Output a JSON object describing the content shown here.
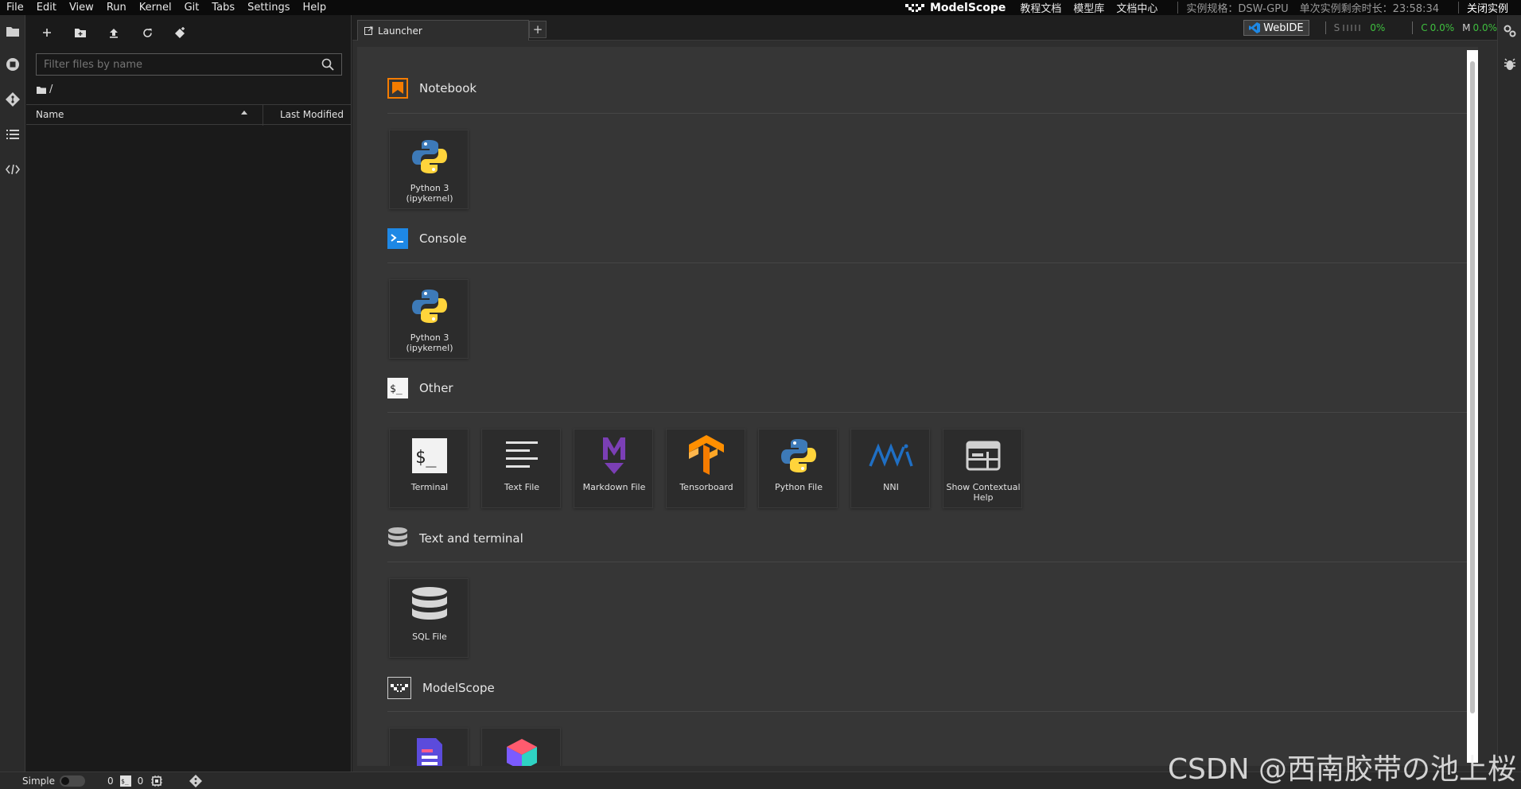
{
  "menu": {
    "items": [
      "File",
      "Edit",
      "View",
      "Run",
      "Kernel",
      "Git",
      "Tabs",
      "Settings",
      "Help"
    ],
    "brand": "ModelScope",
    "links": [
      "教程文档",
      "模型库",
      "文档中心"
    ],
    "instance_spec_label": "实例规格：DSW-GPU",
    "remaining_time_label": "单次实例剩余时长：23:58:34",
    "close_instance": "关闭实例"
  },
  "filebrowser": {
    "filter_placeholder": "Filter files by name",
    "breadcrumb": "/",
    "col_name": "Name",
    "col_modified": "Last Modified"
  },
  "tabs": {
    "launcher_label": "Launcher",
    "add_label": "+"
  },
  "widgets": {
    "webide_label": "WebIDE",
    "s_label": "S",
    "s_value": "0%",
    "c_label": "C",
    "c_value": "0.0%",
    "m_label": "M",
    "m_value": "0.0%"
  },
  "launcher": {
    "sections": [
      {
        "title": "Notebook",
        "icon": "notebook-icon",
        "items": [
          {
            "label": "Python 3\n(ipykernel)",
            "icon": "python-icon"
          }
        ]
      },
      {
        "title": "Console",
        "icon": "console-icon",
        "items": [
          {
            "label": "Python 3\n(ipykernel)",
            "icon": "python-icon"
          }
        ]
      },
      {
        "title": "Other",
        "icon": "other-terminal-icon",
        "items": [
          {
            "label": "Terminal",
            "icon": "terminal-icon"
          },
          {
            "label": "Text File",
            "icon": "text-file-icon"
          },
          {
            "label": "Markdown File",
            "icon": "markdown-icon"
          },
          {
            "label": "Tensorboard",
            "icon": "tensorflow-icon"
          },
          {
            "label": "Python File",
            "icon": "python-icon"
          },
          {
            "label": "NNI",
            "icon": "nni-icon"
          },
          {
            "label": "Show Contextual\nHelp",
            "icon": "contextual-help-icon"
          }
        ]
      },
      {
        "title": "Text and terminal",
        "icon": "database-icon",
        "items": [
          {
            "label": "SQL File",
            "icon": "database-icon"
          }
        ]
      },
      {
        "title": "ModelScope",
        "icon": "modelscope-icon",
        "items": [
          {
            "label": "",
            "icon": "document-icon"
          },
          {
            "label": "",
            "icon": "cube-icon"
          }
        ]
      }
    ]
  },
  "statusbar": {
    "mode_label": "Simple",
    "kernels_count": "0",
    "terminals_count": "0"
  },
  "watermark": "CSDN @西南胶带の池上桜",
  "colors": {
    "accent_orange": "#f57c00",
    "console_blue": "#1e88e5",
    "python_blue": "#3d7ab8",
    "python_yellow": "#ffd43b",
    "markdown_purple": "#7b3fb5",
    "tensorflow_orange": "#ff8f00",
    "nni_blue": "#1f6fc4",
    "meter_green": "#3fbf3f"
  }
}
